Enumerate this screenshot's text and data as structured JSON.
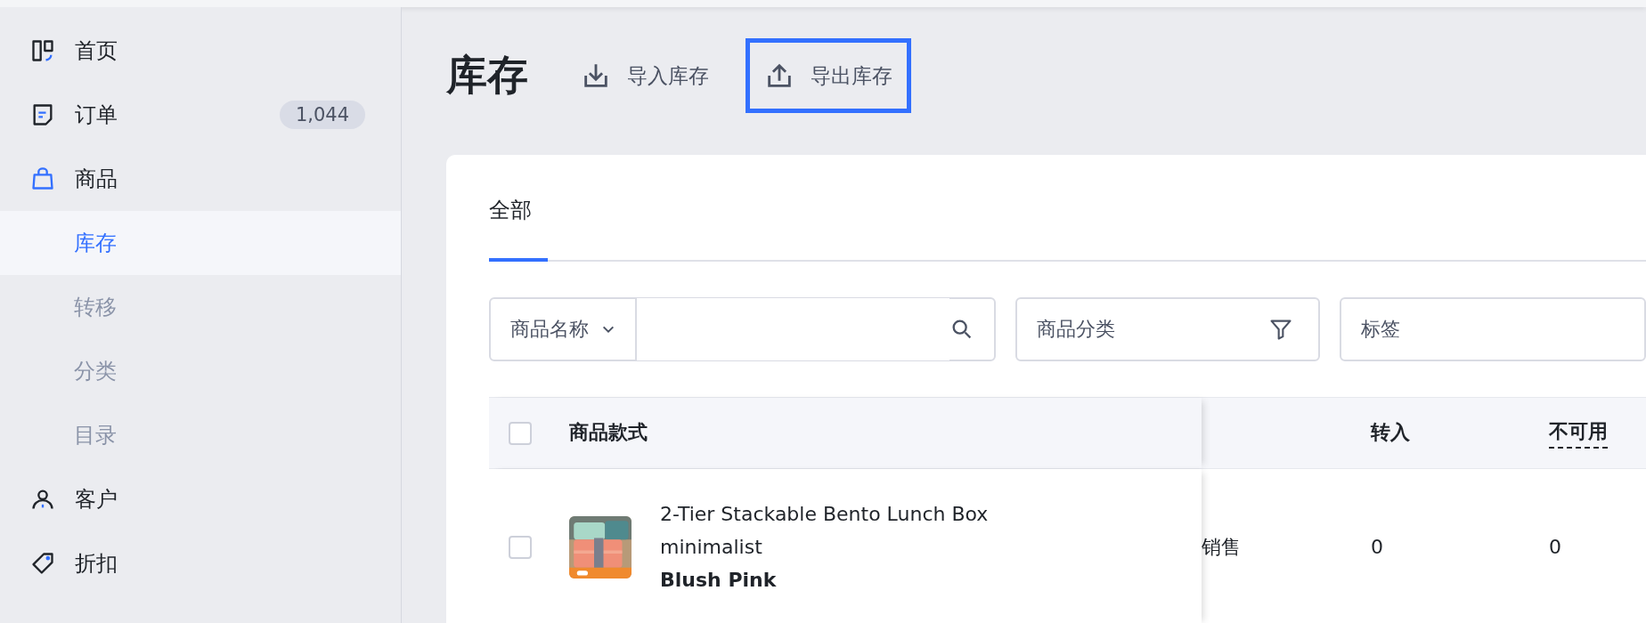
{
  "sidebar": {
    "items": [
      {
        "label": "首页",
        "selected": false
      },
      {
        "label": "订单",
        "selected": false,
        "badge": "1,044"
      },
      {
        "label": "商品",
        "selected": true,
        "children": [
          {
            "label": "库存",
            "selected": true
          },
          {
            "label": "转移",
            "selected": false
          },
          {
            "label": "分类",
            "selected": false
          },
          {
            "label": "目录",
            "selected": false
          }
        ]
      },
      {
        "label": "客户",
        "selected": false
      },
      {
        "label": "折扣",
        "selected": false
      }
    ]
  },
  "header": {
    "title": "库存",
    "actions": [
      {
        "label": "导入库存",
        "focused": false
      },
      {
        "label": "导出库存",
        "focused": true
      }
    ]
  },
  "tabs": [
    {
      "label": "全部",
      "selected": true
    }
  ],
  "filters": {
    "search_scope": "商品名称",
    "category": "商品分类",
    "tags": "标签"
  },
  "table": {
    "header_checked": false,
    "columns": [
      {
        "label": "商品款式",
        "hint": false
      },
      {
        "label": "转入",
        "hint": false
      },
      {
        "label": "不可用",
        "hint": true
      }
    ],
    "rows": [
      {
        "checked": false,
        "kind": "picture",
        "title": "2-Tier Stackable Bento Lunch Box minimalist",
        "variant": "Blush Pink",
        "cells": [
          "销售",
          "0",
          "0"
        ]
      }
    ]
  }
}
